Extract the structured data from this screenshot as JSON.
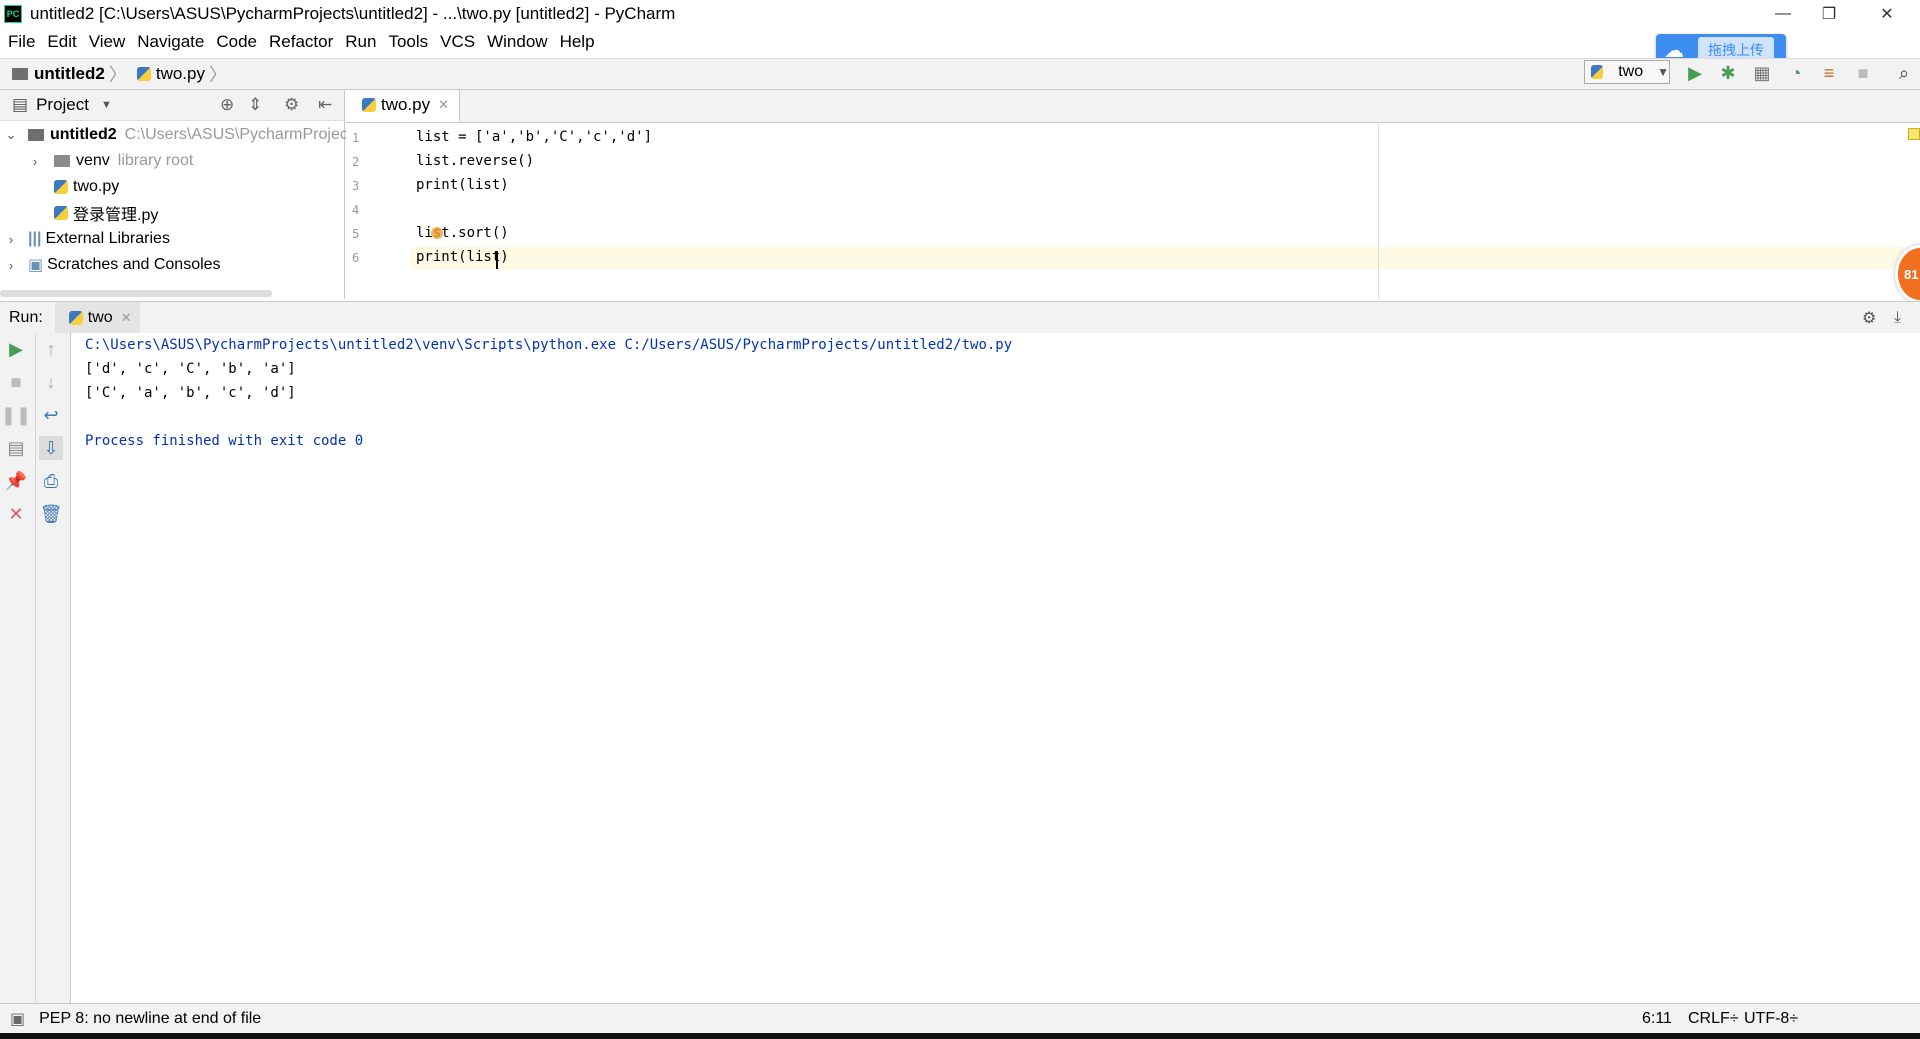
{
  "window": {
    "app_icon": "PC",
    "title": "untitled2 [C:\\Users\\ASUS\\PycharmProjects\\untitled2] - ...\\two.py [untitled2] - PyCharm",
    "minimize": "—",
    "maximize": "❐",
    "close": "✕"
  },
  "menu": [
    "File",
    "Edit",
    "View",
    "Navigate",
    "Code",
    "Refactor",
    "Run",
    "Tools",
    "VCS",
    "Window",
    "Help"
  ],
  "navbar": {
    "project": "untitled2",
    "file": "two.py",
    "run_config": "two"
  },
  "upload_widget": {
    "label": "拖拽上传"
  },
  "project_panel": {
    "title": "Project",
    "tree": [
      {
        "label": "untitled2",
        "hint": "C:\\Users\\ASUS\\PycharmProjec"
      },
      {
        "label": "venv",
        "hint": "library root"
      },
      {
        "label": "two.py"
      },
      {
        "label": "登录管理.py"
      },
      {
        "label": "External Libraries"
      },
      {
        "label": "Scratches and Consoles"
      }
    ]
  },
  "editor": {
    "tab": "two.py",
    "line_numbers": [
      "1",
      "2",
      "3",
      "4",
      "5",
      "6"
    ],
    "lines": [
      "list = ['a','b','C','c','d']",
      "list.reverse()",
      "print(list)",
      "",
      "list.sort()",
      "print(list)"
    ]
  },
  "run_panel": {
    "label": "Run:",
    "tab": "two",
    "output": [
      "C:\\Users\\ASUS\\PycharmProjects\\untitled2\\venv\\Scripts\\python.exe C:/Users/ASUS/PycharmProjects/untitled2/two.py",
      "['d', 'c', 'C', 'b', 'a']",
      "['C', 'a', 'b', 'c', 'd']",
      "",
      "Process finished with exit code 0"
    ]
  },
  "status_bar": {
    "message": "PEP 8: no newline at end of file",
    "position": "6:11",
    "line_sep": "CRLF÷",
    "encoding": "UTF-8÷"
  },
  "overlay": {
    "badge": "81"
  },
  "colors": {
    "accent_blue": "#3d8ef0",
    "run_green": "#499c54",
    "stop_red": "#db5860",
    "console_blue": "#0033b3"
  }
}
